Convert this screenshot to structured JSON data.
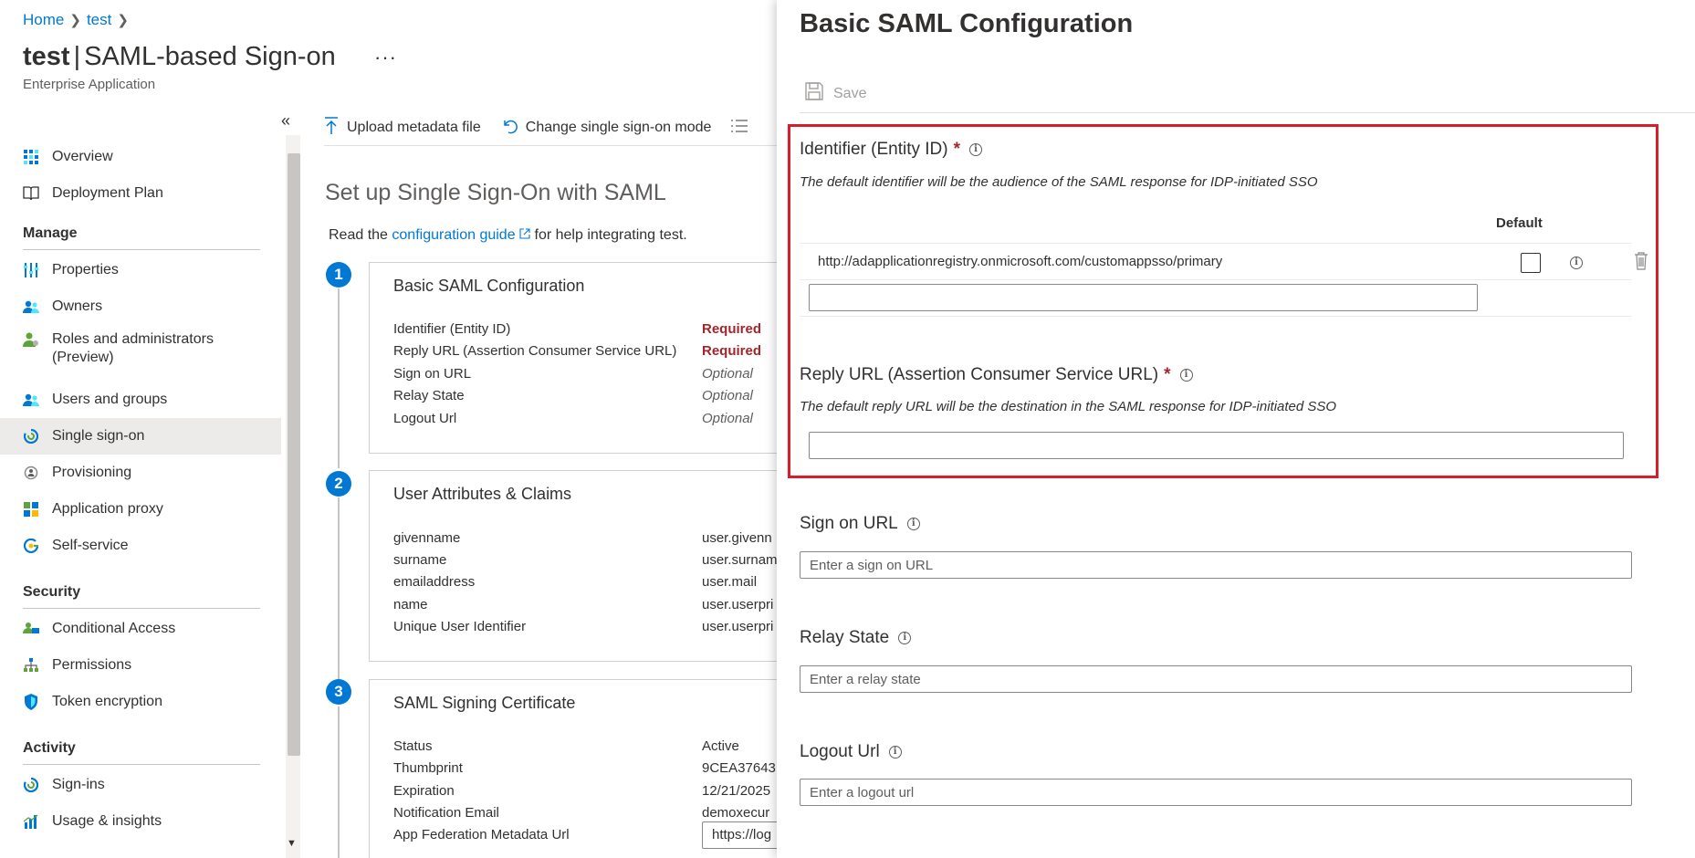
{
  "breadcrumb": {
    "home": "Home",
    "current": "test"
  },
  "page": {
    "title_app": "test",
    "title_separator": "|",
    "title_section": "SAML-based Sign-on",
    "more": "···",
    "subtitle": "Enterprise Application",
    "collapse": "«"
  },
  "sidebar": {
    "items": [
      {
        "label": "Overview",
        "icon": "grid-icon"
      },
      {
        "label": "Deployment Plan",
        "icon": "book-icon"
      }
    ],
    "manage_heading": "Manage",
    "manage_items": [
      {
        "label": "Properties",
        "icon": "properties-icon"
      },
      {
        "label": "Owners",
        "icon": "owners-icon"
      },
      {
        "label": "Roles and administrators (Preview)",
        "icon": "roles-icon"
      },
      {
        "label": "Users and groups",
        "icon": "users-groups-icon"
      },
      {
        "label": "Single sign-on",
        "icon": "sso-icon"
      },
      {
        "label": "Provisioning",
        "icon": "provisioning-icon"
      },
      {
        "label": "Application proxy",
        "icon": "app-proxy-icon"
      },
      {
        "label": "Self-service",
        "icon": "self-service-icon"
      }
    ],
    "security_heading": "Security",
    "security_items": [
      {
        "label": "Conditional Access",
        "icon": "conditional-access-icon"
      },
      {
        "label": "Permissions",
        "icon": "permissions-icon"
      },
      {
        "label": "Token encryption",
        "icon": "shield-icon"
      }
    ],
    "activity_heading": "Activity",
    "activity_items": [
      {
        "label": "Sign-ins",
        "icon": "sign-ins-icon"
      },
      {
        "label": "Usage & insights",
        "icon": "chart-icon"
      }
    ]
  },
  "toolbar": {
    "upload": "Upload metadata file",
    "change_mode": "Change single sign-on mode"
  },
  "content": {
    "title": "Set up Single Sign-On with SAML",
    "intro_before": "Read the ",
    "intro_link": "configuration guide",
    "intro_after": " for help integrating test."
  },
  "steps": {
    "s1": {
      "num": "1",
      "title": "Basic SAML Configuration",
      "rows": [
        {
          "k": "Identifier (Entity ID)",
          "v": "Required"
        },
        {
          "k": "Reply URL (Assertion Consumer Service URL)",
          "v": "Required"
        },
        {
          "k": "Sign on URL",
          "v": "Optional"
        },
        {
          "k": "Relay State",
          "v": "Optional"
        },
        {
          "k": "Logout Url",
          "v": "Optional"
        }
      ]
    },
    "s2": {
      "num": "2",
      "title": "User Attributes & Claims",
      "rows": [
        {
          "k": "givenname",
          "v": "user.givenn"
        },
        {
          "k": "surname",
          "v": "user.surnam"
        },
        {
          "k": "emailaddress",
          "v": "user.mail"
        },
        {
          "k": "name",
          "v": "user.userpri"
        },
        {
          "k": "Unique User Identifier",
          "v": "user.userpri"
        }
      ]
    },
    "s3": {
      "num": "3",
      "title": "SAML Signing Certificate",
      "rows": [
        {
          "k": "Status",
          "v": "Active"
        },
        {
          "k": "Thumbprint",
          "v": "9CEA37643"
        },
        {
          "k": "Expiration",
          "v": "12/21/2025"
        },
        {
          "k": "Notification Email",
          "v": "demoxecur"
        },
        {
          "k": "App Federation Metadata Url",
          "v": "https://log"
        }
      ]
    }
  },
  "panel": {
    "title": "Basic SAML Configuration",
    "save": "Save",
    "identifier": {
      "label": "Identifier (Entity ID)",
      "required_mark": "*",
      "description": "The default identifier will be the audience of the SAML response for IDP-initiated SSO",
      "default_header": "Default",
      "value": "http://adapplicationregistry.onmicrosoft.com/customappsso/primary",
      "new_value": ""
    },
    "reply": {
      "label": "Reply URL (Assertion Consumer Service URL)",
      "required_mark": "*",
      "description": "The default reply URL will be the destination in the SAML response for IDP-initiated SSO",
      "value": ""
    },
    "sign_on": {
      "label": "Sign on URL",
      "placeholder": "Enter a sign on URL"
    },
    "relay": {
      "label": "Relay State",
      "placeholder": "Enter a relay state"
    },
    "logout": {
      "label": "Logout Url",
      "placeholder": "Enter a logout url"
    }
  },
  "colors": {
    "accent": "#0078d4",
    "required": "#a4262c",
    "highlight": "#d61f2b"
  }
}
